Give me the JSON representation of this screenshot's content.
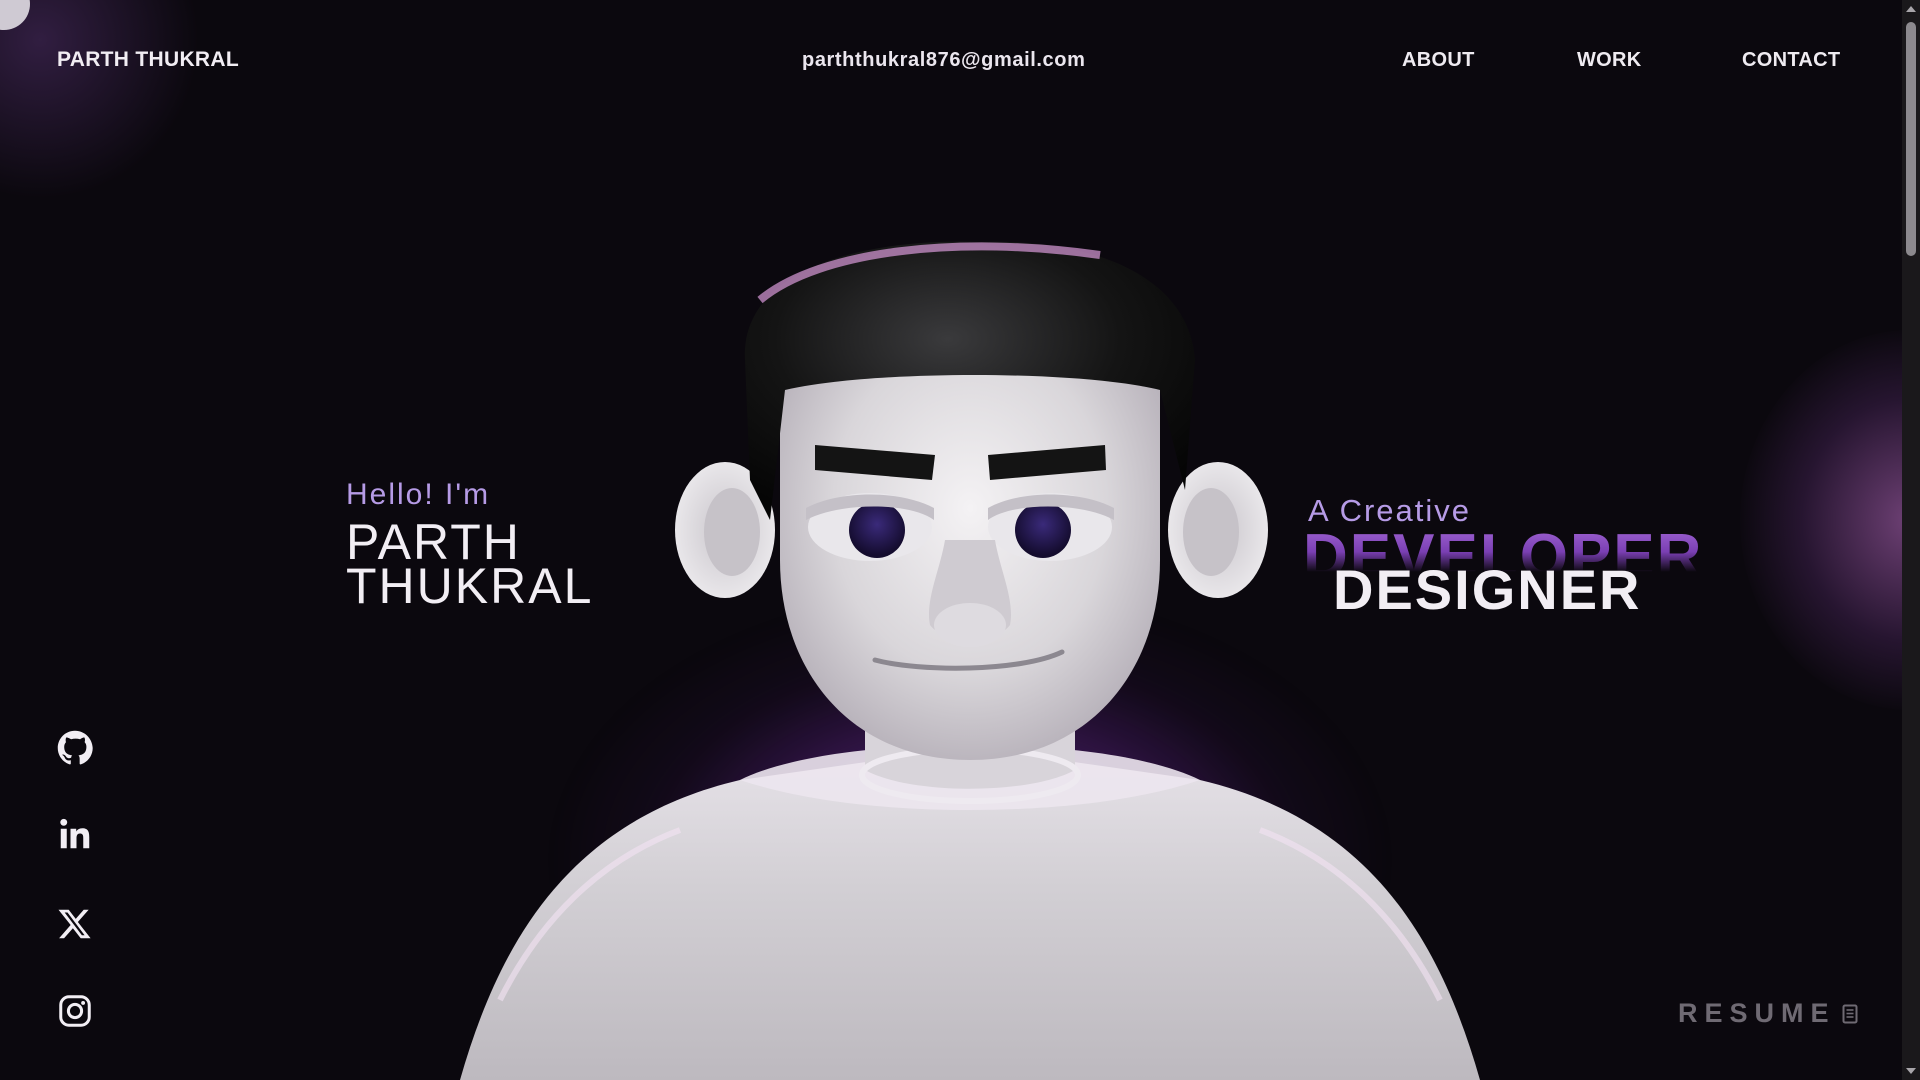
{
  "header": {
    "logo": "PARTH THUKRAL",
    "email": "parththukral876@gmail.com",
    "nav": {
      "about": "ABOUT",
      "work": "WORK",
      "contact": "CONTACT"
    }
  },
  "intro": {
    "greeting": "Hello! I'm",
    "name_line_1": "PARTH",
    "name_line_2": "THUKRAL"
  },
  "role": {
    "prefix": "A Creative",
    "word_back": "DEVELOPER",
    "word_front": "DESIGNER"
  },
  "social": {
    "icons": [
      "github-icon",
      "linkedin-icon",
      "x-icon",
      "instagram-icon"
    ]
  },
  "resume": {
    "label": "RESUME"
  },
  "colors": {
    "background": "#0b080e",
    "accent": "#b69be6",
    "text": "#f2eef4",
    "glow": "#9646c8"
  }
}
